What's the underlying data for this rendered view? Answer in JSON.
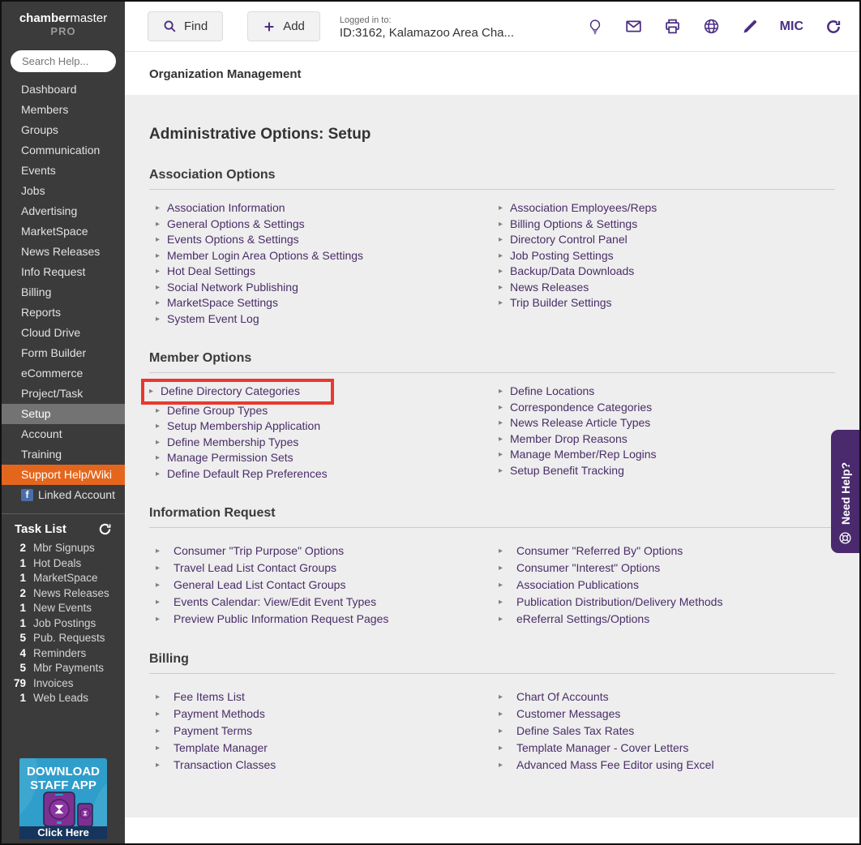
{
  "header": {
    "find_label": "Find",
    "add_label": "Add",
    "logged_in_label": "Logged in to:",
    "logged_in_value": "ID:3162, Kalamazoo Area Cha...",
    "mic_label": "MIC"
  },
  "sidebar": {
    "logo": {
      "bold": "chamber",
      "regular": "master",
      "sub": "PRO"
    },
    "search_placeholder": "Search Help...",
    "items": [
      {
        "label": "Dashboard"
      },
      {
        "label": "Members"
      },
      {
        "label": "Groups"
      },
      {
        "label": "Communication"
      },
      {
        "label": "Events"
      },
      {
        "label": "Jobs"
      },
      {
        "label": "Advertising"
      },
      {
        "label": "MarketSpace"
      },
      {
        "label": "News Releases"
      },
      {
        "label": "Info Request"
      },
      {
        "label": "Billing"
      },
      {
        "label": "Reports"
      },
      {
        "label": "Cloud Drive"
      },
      {
        "label": "Form Builder"
      },
      {
        "label": "eCommerce"
      },
      {
        "label": "Project/Task"
      },
      {
        "label": "Setup",
        "active": true
      },
      {
        "label": "Account"
      },
      {
        "label": "Training"
      },
      {
        "label": "Support Help/Wiki",
        "variant": "support"
      },
      {
        "label": "Linked Account",
        "icon": "facebook-icon"
      }
    ],
    "task_list": {
      "title": "Task List",
      "items": [
        {
          "count": "2",
          "label": "Mbr Signups"
        },
        {
          "count": "1",
          "label": "Hot Deals"
        },
        {
          "count": "1",
          "label": "MarketSpace"
        },
        {
          "count": "2",
          "label": "News Releases"
        },
        {
          "count": "1",
          "label": "New Events"
        },
        {
          "count": "1",
          "label": "Job Postings"
        },
        {
          "count": "5",
          "label": "Pub. Requests"
        },
        {
          "count": "4",
          "label": "Reminders"
        },
        {
          "count": "5",
          "label": "Mbr Payments"
        },
        {
          "count": "79",
          "label": "Invoices"
        },
        {
          "count": "1",
          "label": "Web Leads"
        }
      ]
    },
    "banner": {
      "line1": "DOWNLOAD",
      "line2": "STAFF APP",
      "button": "Click Here"
    }
  },
  "breadcrumb": "Organization Management",
  "main": {
    "title": "Administrative Options: Setup",
    "sections": [
      {
        "heading": "Association Options",
        "columns": [
          {
            "links": [
              {
                "label": "Association Information"
              },
              {
                "label": "General Options & Settings"
              },
              {
                "label": "Events Options & Settings"
              },
              {
                "label": "Member Login Area Options & Settings"
              },
              {
                "label": "Hot Deal Settings"
              },
              {
                "label": "Social Network Publishing"
              },
              {
                "label": "MarketSpace Settings"
              },
              {
                "label": "System Event Log"
              }
            ]
          },
          {
            "links": [
              {
                "label": "Association Employees/Reps"
              },
              {
                "label": "Billing Options & Settings"
              },
              {
                "label": "Directory Control Panel"
              },
              {
                "label": "Job Posting Settings"
              },
              {
                "label": "Backup/Data Downloads"
              },
              {
                "label": "News Releases"
              },
              {
                "label": "Trip Builder Settings"
              }
            ]
          }
        ]
      },
      {
        "heading": "Member Options",
        "columns": [
          {
            "links": [
              {
                "label": "Define Directory Categories",
                "highlight": true
              },
              {
                "label": "Define Group Types"
              },
              {
                "label": "Setup Membership Application"
              },
              {
                "label": "Define Membership Types"
              },
              {
                "label": "Manage Permission Sets"
              },
              {
                "label": "Define Default Rep Preferences"
              }
            ]
          },
          {
            "links": [
              {
                "label": "Define Locations"
              },
              {
                "label": "Correspondence Categories"
              },
              {
                "label": "News Release Article Types"
              },
              {
                "label": "Member Drop Reasons"
              },
              {
                "label": "Manage Member/Rep Logins"
              },
              {
                "label": "Setup Benefit Tracking"
              }
            ]
          }
        ]
      },
      {
        "heading": "Information Request",
        "columns": [
          {
            "links": [
              {
                "label": "Consumer \"Trip Purpose\" Options"
              },
              {
                "label": "Travel Lead List Contact Groups"
              },
              {
                "label": "General Lead List Contact Groups"
              },
              {
                "label": "Events Calendar: View/Edit Event Types"
              },
              {
                "label": "Preview Public Information Request Pages"
              }
            ]
          },
          {
            "links": [
              {
                "label": "Consumer \"Referred By\" Options"
              },
              {
                "label": "Consumer \"Interest\" Options"
              },
              {
                "label": "Association Publications"
              },
              {
                "label": "Publication Distribution/Delivery Methods"
              },
              {
                "label": "eReferral Settings/Options"
              }
            ]
          }
        ]
      },
      {
        "heading": "Billing",
        "columns": [
          {
            "links": [
              {
                "label": "Fee Items List"
              },
              {
                "label": "Payment Methods"
              },
              {
                "label": "Payment Terms"
              },
              {
                "label": "Template Manager"
              },
              {
                "label": "Transaction Classes"
              }
            ]
          },
          {
            "links": [
              {
                "label": "Chart Of Accounts"
              },
              {
                "label": "Customer Messages"
              },
              {
                "label": "Define Sales Tax Rates"
              },
              {
                "label": "Template Manager - Cover Letters"
              },
              {
                "label": "Advanced Mass Fee Editor using Excel"
              }
            ]
          }
        ]
      }
    ]
  },
  "need_help_label": "Need Help?",
  "colors": {
    "accent_purple": "#4b2e83",
    "link_purple": "#4a2d68",
    "highlight_red": "#e8392e",
    "support_orange": "#e4661c",
    "sidebar_dark": "#3b3b3b"
  }
}
